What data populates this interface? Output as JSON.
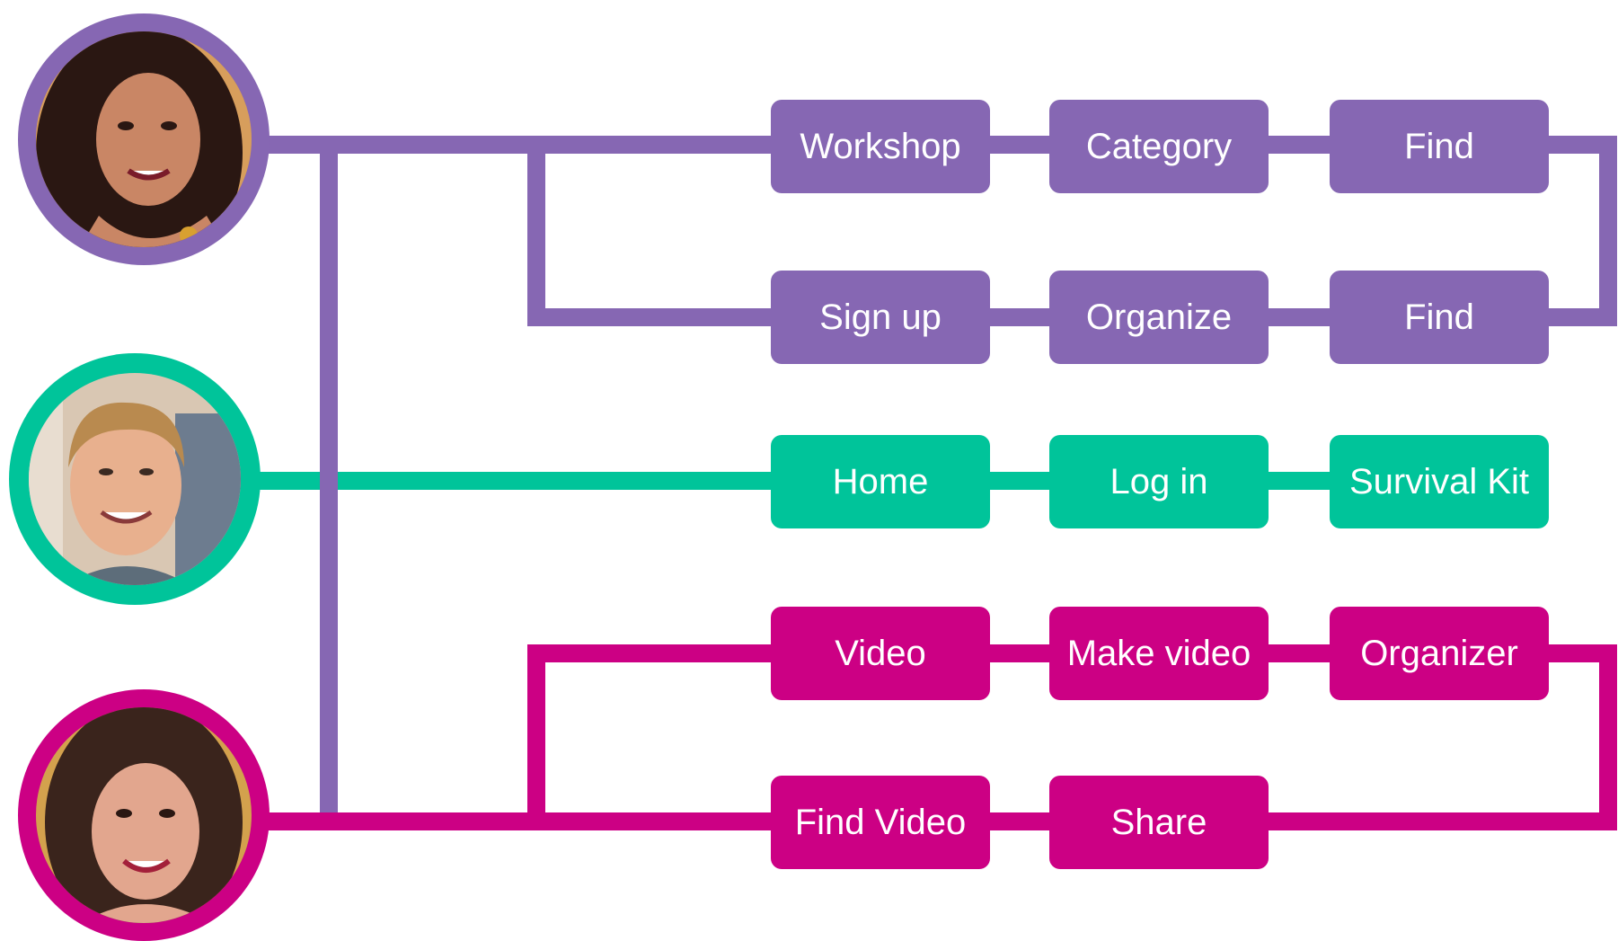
{
  "colors": {
    "purple": "#8667b3",
    "teal": "#00c49a",
    "magenta": "#cc0084",
    "background": "#ffffff"
  },
  "personas": [
    {
      "color": "purple",
      "avatar": "woman-dark-hair-avatar"
    },
    {
      "color": "teal",
      "avatar": "man-blond-hair-avatar"
    },
    {
      "color": "magenta",
      "avatar": "woman-brunette-avatar"
    }
  ],
  "flows": {
    "purple": {
      "row1": [
        "Workshop",
        "Category",
        "Find"
      ],
      "row2": [
        "Sign up",
        "Organize",
        "Find"
      ]
    },
    "teal": {
      "row1": [
        "Home",
        "Log in",
        "Survival Kit"
      ]
    },
    "magenta": {
      "row1": [
        "Video",
        "Make video",
        "Organizer"
      ],
      "row2": [
        "Find Video",
        "Share"
      ]
    }
  }
}
